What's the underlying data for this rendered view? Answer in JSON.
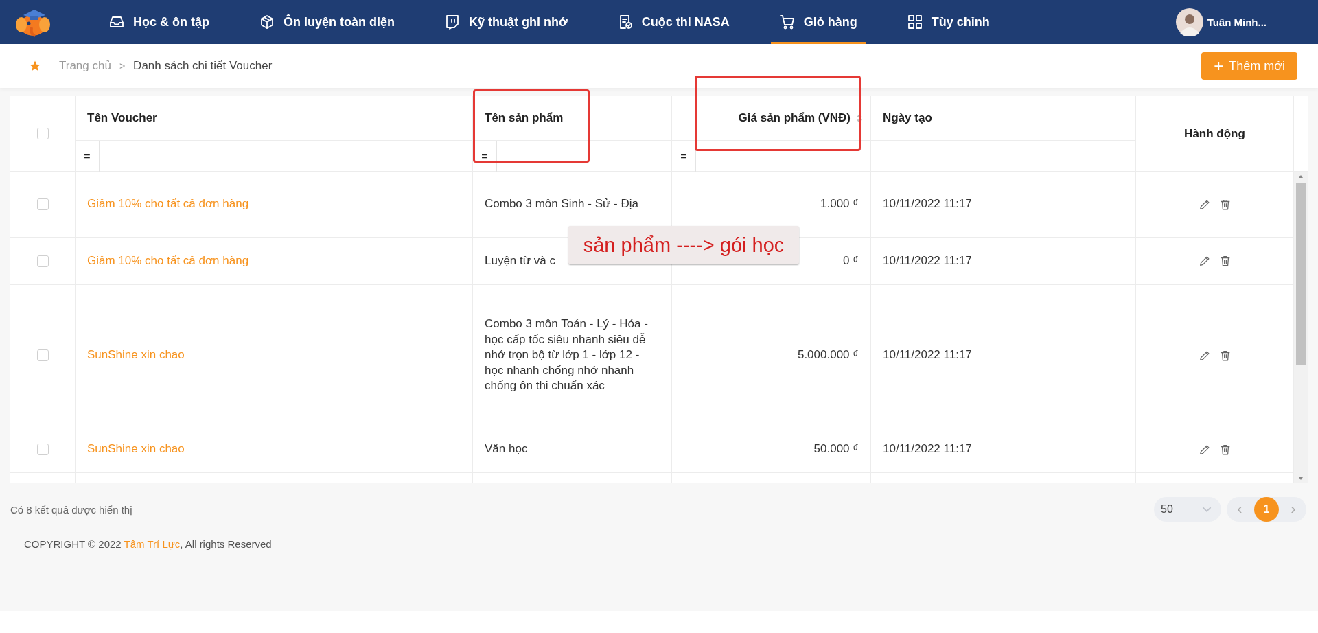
{
  "nav": {
    "items": [
      {
        "label": "Học & ôn tập",
        "selected": false
      },
      {
        "label": "Ôn luyện toàn diện",
        "selected": false
      },
      {
        "label": "Kỹ thuật ghi nhớ",
        "selected": false
      },
      {
        "label": "Cuộc thi NASA",
        "selected": false
      },
      {
        "label": "Giỏ hàng",
        "selected": true
      },
      {
        "label": "Tùy chỉnh",
        "selected": false
      }
    ],
    "user": {
      "name": "Tuấn Minh..."
    }
  },
  "breadcrumb": [
    {
      "label": "Trang chủ"
    },
    {
      "label": "Danh sách chi tiết Voucher"
    }
  ],
  "breadcrumb_separator": ">",
  "add_button": {
    "icon": "+",
    "label": "Thêm mới"
  },
  "table": {
    "select_all": {
      "checked": false
    },
    "columns": [
      {
        "label": "Tên Voucher",
        "filter": "=",
        "highlighted": false,
        "sortable": false
      },
      {
        "label": "Tên sản phẩm",
        "filter": "=",
        "highlighted": true,
        "sortable": false
      },
      {
        "label": "Giá sản phẩm (VNĐ)",
        "filter": "=",
        "highlighted": true,
        "sortable": true
      },
      {
        "label": "Ngày tạo",
        "highlighted": false,
        "sortable": false
      },
      {
        "label": "Hành động",
        "highlighted": false,
        "sortable": false
      }
    ],
    "rows": [
      {
        "checked": false,
        "voucher": "Giảm 10% cho tất cả đơn hàng",
        "product": "Combo 3 môn Sinh - Sử - Địa",
        "price": "1.000 ₫",
        "created": "10/11/2022 11:17"
      },
      {
        "checked": false,
        "voucher": "Giảm 10% cho tất cả đơn hàng",
        "product": "Luyện từ và c",
        "price": "0 ₫",
        "created": "10/11/2022 11:17"
      },
      {
        "checked": false,
        "voucher": "SunShine xin chao",
        "product": "Combo 3 môn Toán - Lý - Hóa - học cấp tốc siêu nhanh siêu dễ nhớ trọn bộ từ lớp 1 - lớp 12 - học nhanh chống nhớ nhanh chống ôn thi chuẩn xác",
        "price": "5.000.000 ₫",
        "created": "10/11/2022 11:17"
      },
      {
        "checked": false,
        "voucher": "SunShine xin chao",
        "product": "Văn học",
        "price": "50.000 ₫",
        "created": "10/11/2022 11:17"
      }
    ]
  },
  "annotation": {
    "note": "sản phẩm ----> gói học"
  },
  "result_count": "Có 8 kết quả được hiển thị",
  "pagination": {
    "page_size": "50",
    "prev": "‹",
    "next": "›",
    "pages": [
      {
        "label": "1",
        "selected": true
      }
    ]
  },
  "footer": {
    "before": "COPYRIGHT © 2022 ",
    "brand": "Tâm Trí Lực",
    "after": ", All rights Reserved"
  }
}
